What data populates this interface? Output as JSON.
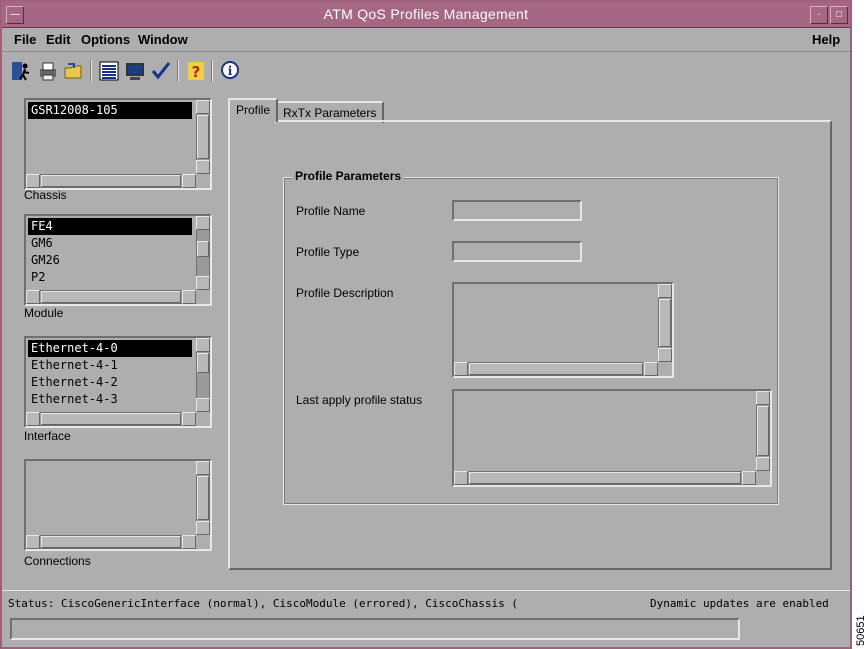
{
  "window": {
    "title": "ATM QoS Profiles Management"
  },
  "menu": {
    "file": "File",
    "edit": "Edit",
    "options": "Options",
    "window": "Window",
    "help": "Help"
  },
  "toolbar": {
    "icons": [
      "exit-icon",
      "printer-icon",
      "open-folder-icon",
      "list-icon",
      "monitor-icon",
      "checkmark-icon",
      "help-icon",
      "info-icon"
    ]
  },
  "chassis": {
    "label": "Chassis",
    "items": [
      "GSR12008-105"
    ]
  },
  "module": {
    "label": "Module",
    "items": [
      "FE4",
      "GM6",
      "GM26",
      "P2"
    ]
  },
  "interface": {
    "label": "Interface",
    "items": [
      "Ethernet-4-0",
      "Ethernet-4-1",
      "Ethernet-4-2",
      "Ethernet-4-3"
    ]
  },
  "connections": {
    "label": "Connections",
    "items": []
  },
  "tabs": [
    {
      "label": "Profile"
    },
    {
      "label": "RxTx Parameters"
    }
  ],
  "profile": {
    "group_title": "Profile Parameters",
    "name_label": "Profile Name",
    "name_value": "",
    "type_label": "Profile Type",
    "type_value": "",
    "description_label": "Profile Description",
    "status_label": "Last apply profile status"
  },
  "status": {
    "text": "Status: CiscoGenericInterface (normal), CiscoModule (errored), CiscoChassis (",
    "updates": "Dynamic updates are enabled"
  },
  "figure_id": "50651",
  "colors": {
    "titlebar": "#a56783",
    "background": "#aeaeae",
    "selection": "#000000"
  }
}
